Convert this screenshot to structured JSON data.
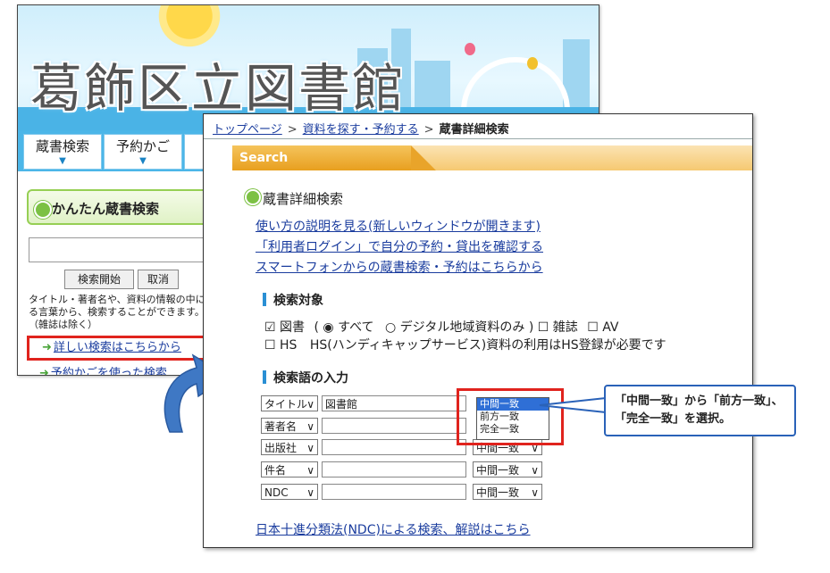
{
  "back_page": {
    "banner_title": "葛飾区立図書館",
    "nav": [
      "蔵書検索",
      "予約かご"
    ],
    "easy_search": {
      "title": "かんたん蔵書検索",
      "search_button": "検索開始",
      "cancel_button": "取消",
      "description": "タイトル・著者名や、資料の情報の中にある言葉から、検索することができます。（雑誌は除く）",
      "detail_link": "詳しい検索はこちらから",
      "cart_link": "予約かごを使った検索"
    }
  },
  "front_page": {
    "breadcrumb": [
      "トップページ",
      "資料を探す・予約する",
      "蔵書詳細検索"
    ],
    "tab_label": "Search",
    "page_title": "蔵書詳細検索",
    "links": [
      "使い方の説明を見る(新しいウィンドウが開きます)",
      "「利用者ログイン」で自分の予約・貸出を確認する",
      "スマートフォンからの蔵書検索・予約はこちらから"
    ],
    "target_section": {
      "heading": "検索対象",
      "row1": {
        "books": "図書",
        "open_paren": "(",
        "all": "すべて",
        "digital": "デジタル地域資料のみ",
        "close_paren": ")",
        "magazines": "雑誌",
        "av": "AV"
      },
      "row2": {
        "hs": "HS",
        "hs_note": "HS(ハンディキャップサービス)資料の利用はHS登録が必要です"
      }
    },
    "terms_section": {
      "heading": "検索語の入力",
      "rows": [
        {
          "field": "タイトル",
          "value": "図書館",
          "match": "中間一致"
        },
        {
          "field": "著者名",
          "value": "",
          "match": "中間一致"
        },
        {
          "field": "出版社",
          "value": "",
          "match": "中間一致"
        },
        {
          "field": "件名",
          "value": "",
          "match": "中間一致"
        },
        {
          "field": "NDC",
          "value": "",
          "match": "中間一致"
        }
      ],
      "match_options": [
        "中間一致",
        "前方一致",
        "完全一致"
      ]
    },
    "ndc_link": "日本十進分類法(NDC)による検索、解説はこちら"
  },
  "callout": {
    "text": "「中間一致」から「前方一致」、「完全一致」を選択。"
  },
  "colors": {
    "highlight_red": "#e0231d",
    "callout_blue": "#2a62b8",
    "link_blue": "#1a3c9e",
    "tab_orange": "#e89f1f",
    "nav_blue": "#4cb6e8"
  },
  "icons": [
    "green-arrow-icon",
    "curved-arrow-icon",
    "green-dot-icon",
    "checkbox-icon",
    "radio-icon",
    "chevron-down-icon"
  ]
}
